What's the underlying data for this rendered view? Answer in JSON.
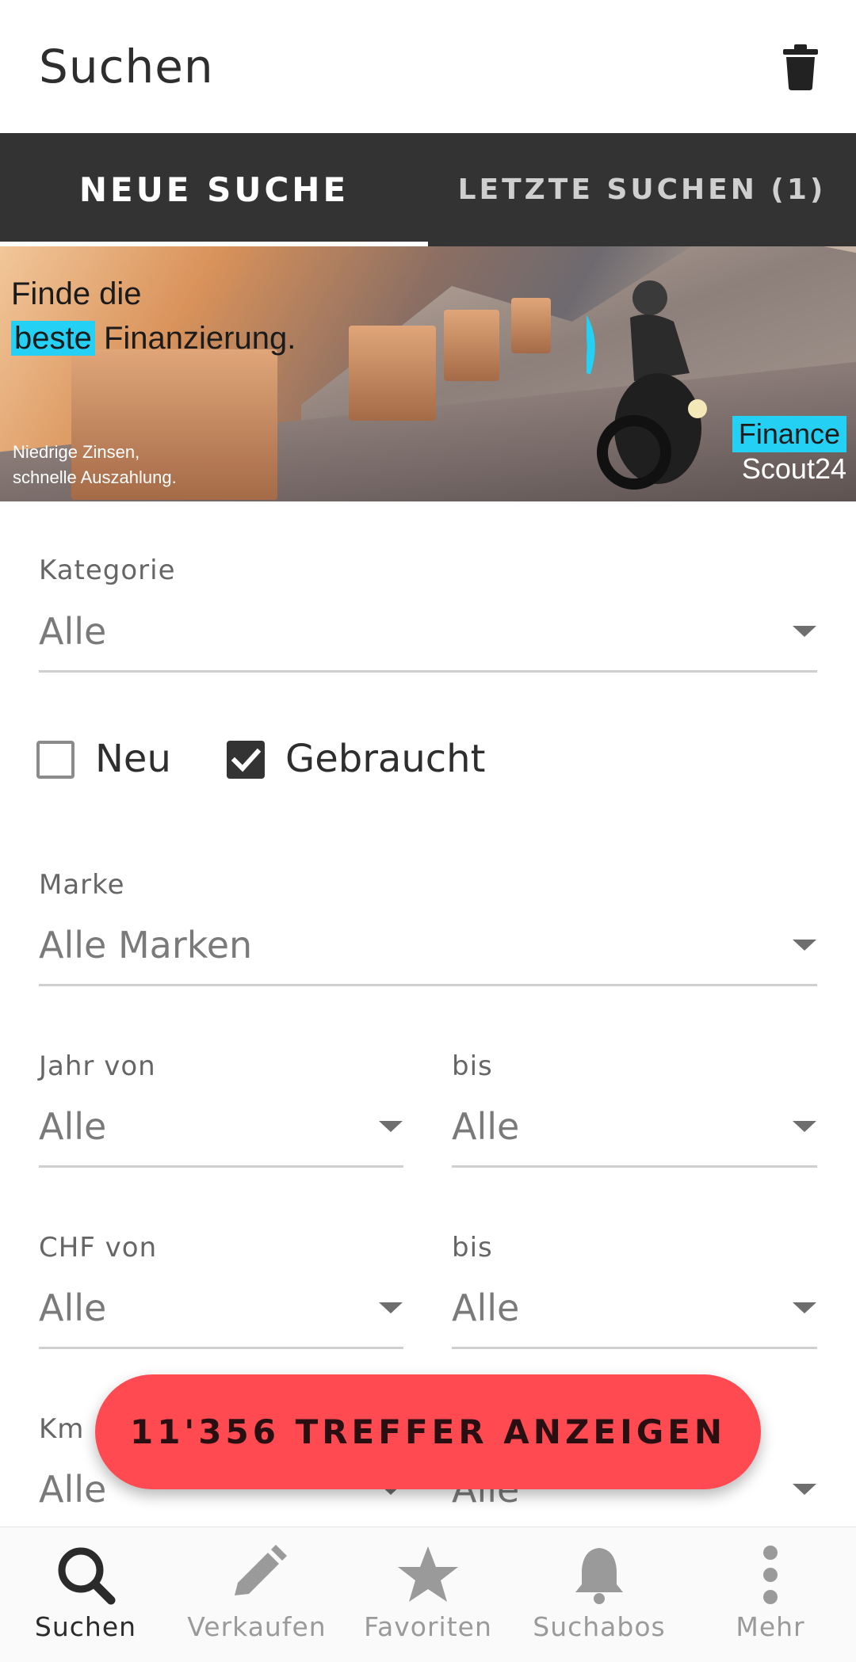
{
  "appbar": {
    "title": "Suchen",
    "delete_icon": "trash-icon"
  },
  "tabs": [
    {
      "label": "NEUE SUCHE",
      "active": true
    },
    {
      "label": "LETZTE SUCHEN (1)",
      "active": false
    }
  ],
  "banner": {
    "headline_line1": "Finde die",
    "headline_highlight": "beste",
    "headline_rest": "Finanzierung.",
    "sub_line1": "Niedrige Zinsen,",
    "sub_line2": "schnelle Auszahlung.",
    "brand_line1": "Finance",
    "brand_line2": "Scout24",
    "brand_color": "#25d0f5"
  },
  "form": {
    "kategorie": {
      "label": "Kategorie",
      "value": "Alle"
    },
    "condition": {
      "neu": {
        "label": "Neu",
        "checked": false
      },
      "gebraucht": {
        "label": "Gebraucht",
        "checked": true
      }
    },
    "marke": {
      "label": "Marke",
      "value": "Alle Marken"
    },
    "jahr_von": {
      "label": "Jahr von",
      "value": "Alle"
    },
    "jahr_bis": {
      "label": "bis",
      "value": "Alle"
    },
    "chf_von": {
      "label": "CHF von",
      "value": "Alle"
    },
    "chf_bis": {
      "label": "bis",
      "value": "Alle"
    },
    "km_von": {
      "label": "Km",
      "value": "Alle"
    },
    "km_bis": {
      "value": "Alle"
    }
  },
  "results_button": {
    "label": "11'356 TREFFER ANZEIGEN",
    "color": "#ff4a52"
  },
  "bottom_nav": [
    {
      "label": "Suchen",
      "icon": "search-icon",
      "active": true
    },
    {
      "label": "Verkaufen",
      "icon": "pencil-icon",
      "active": false
    },
    {
      "label": "Favoriten",
      "icon": "star-icon",
      "active": false
    },
    {
      "label": "Suchabos",
      "icon": "bell-icon",
      "active": false
    },
    {
      "label": "Mehr",
      "icon": "more-vertical-icon",
      "active": false
    }
  ]
}
